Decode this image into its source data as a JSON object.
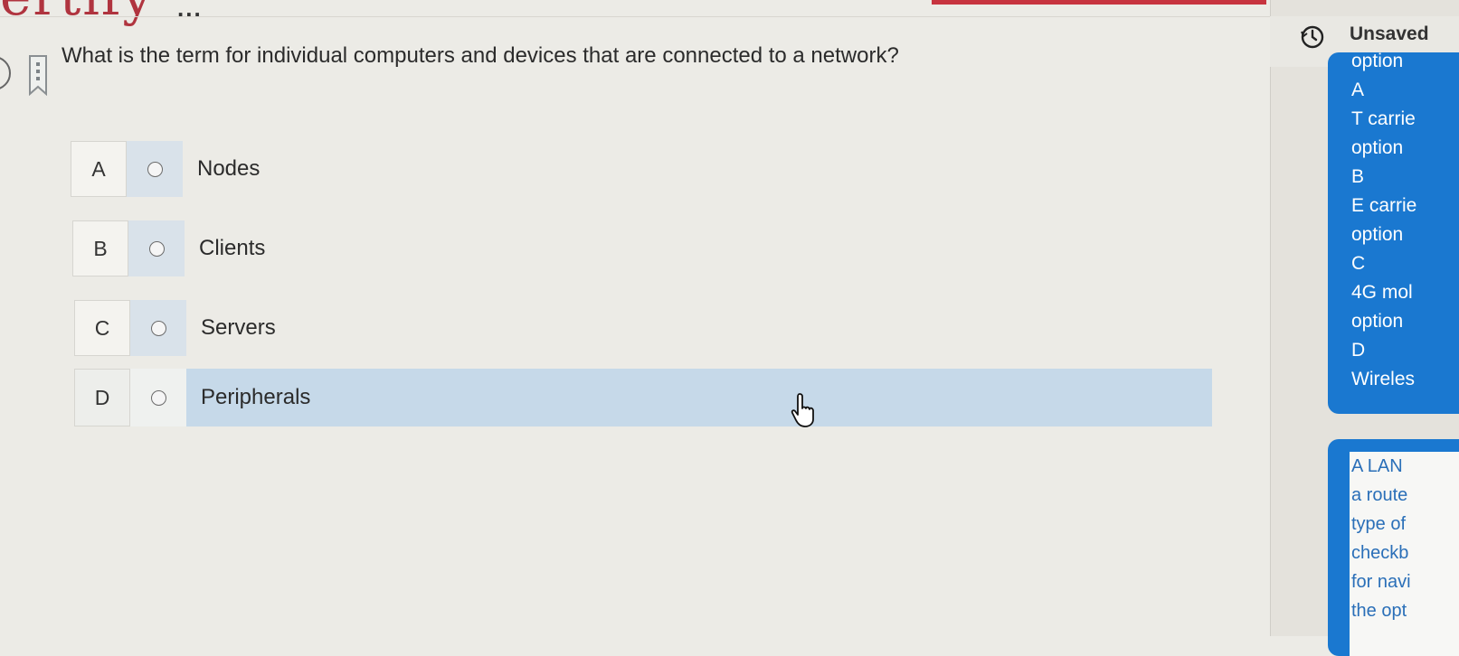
{
  "header": {
    "brand_fragment": "ertify",
    "more_label": "..."
  },
  "question": {
    "text": "What is the term for individual computers and devices that are connected to a network?"
  },
  "options": [
    {
      "letter": "A",
      "label": "Nodes"
    },
    {
      "letter": "B",
      "label": "Clients"
    },
    {
      "letter": "C",
      "label": "Servers"
    },
    {
      "letter": "D",
      "label": "Peripherals"
    }
  ],
  "hovered_option": "D",
  "right_panel": {
    "status_icon": "history-clock-icon",
    "status_text": "Unsaved",
    "annotation_lines": [
      "option",
      "A",
      "T carrie",
      "option",
      "B",
      "E carrie",
      "option",
      "C",
      "4G mol",
      "option",
      "D",
      "Wireles"
    ],
    "description_lines": [
      "A LAN",
      "a route",
      "type of",
      "checkb",
      "for navi",
      "the opt"
    ]
  },
  "colors": {
    "accent_blue": "#1a78d0",
    "hover_blue": "#c6d9e9",
    "brand_red": "#c7343f"
  }
}
